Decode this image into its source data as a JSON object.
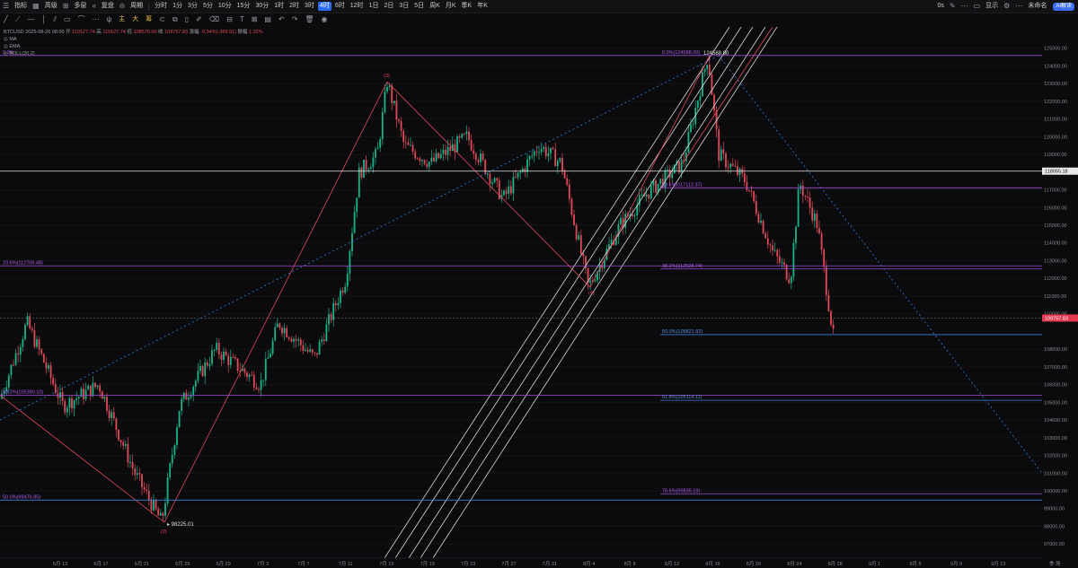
{
  "toolbar": {
    "indicator_label": "指标",
    "advanced_label": "高级",
    "multi_chart_label": "多窗",
    "replay_label": "复盘",
    "period_label": "周期",
    "intervals": [
      "分时",
      "1分",
      "3分",
      "5分",
      "10分",
      "15分",
      "30分",
      "1时",
      "2时",
      "3时",
      "4时",
      "6时",
      "12时",
      "1日",
      "2日",
      "3日",
      "5日",
      "周K",
      "月K",
      "季K",
      "年K"
    ],
    "active_interval": "4时",
    "right_zoom": "0s",
    "right_display": "显示",
    "right_unnamed": "未命名",
    "ai_button": "AI解读"
  },
  "drawing_tools": {
    "yellow_items": [
      "主",
      "大",
      "筹"
    ]
  },
  "legend": {
    "symbol": "BTCUSD",
    "date": "2025-08-26 08:00",
    "open_label": "开",
    "open": "110127.74",
    "high_label": "高",
    "high": "110127.74",
    "low_label": "低",
    "low": "108570.00",
    "close_label": "收",
    "close": "109757.83",
    "change_label": "涨幅",
    "change": "-0.34%(-369.91)",
    "amplitude_label": "振幅",
    "amplitude": "1.32%",
    "ma_label": "MA",
    "ema_label": "EMA",
    "boll_label": "BOLL(20,2)"
  },
  "colors": {
    "up": "#19b38a",
    "down": "#e04a58",
    "fib_line": "#a14dd6",
    "fib_line_blue": "#3c7fd6",
    "fib_text": "#b05cf0",
    "elliott": "#e04a58",
    "white_line": "#d8d8d8",
    "dotted": "#2f7fd9",
    "current_price_bg": "#e5394f",
    "axis_text": "#8a8a90"
  },
  "price_axis": {
    "ticks": [
      "125000.00",
      "124000.00",
      "123000.00",
      "122000.00",
      "121000.00",
      "120000.00",
      "119000.00",
      "117000.00",
      "116000.00",
      "115000.00",
      "114000.00",
      "113000.00",
      "112000.00",
      "111000.00",
      "110000.00",
      "108000.00",
      "107000.00",
      "106000.00",
      "105000.00",
      "104000.00",
      "103000.00",
      "102000.00",
      "101000.00",
      "100000.00",
      "99000.00",
      "98000.00",
      "97000.00"
    ],
    "tick_values": [
      125000,
      124000,
      123000,
      122000,
      121000,
      120000,
      119000,
      117000,
      116000,
      115000,
      114000,
      113000,
      112000,
      111000,
      110000,
      108000,
      107000,
      106000,
      105000,
      104000,
      103000,
      102000,
      101000,
      100000,
      99000,
      98000,
      97000
    ],
    "marked_white": "118055.18",
    "marked_white_value": 118055.18,
    "current_price": "109757.83",
    "current_price_value": 109757.83,
    "min": 96200,
    "max": 126200
  },
  "time_axis": {
    "labels": [
      "6月 13",
      "6月 17",
      "6月 21",
      "6月 25",
      "6月 29",
      "7月 3",
      "7月 7",
      "7月 11",
      "7月 15",
      "7月 19",
      "7月 23",
      "7月 27",
      "7月 31",
      "8月 4",
      "8月 8",
      "8月 12",
      "8月 16",
      "8月 20",
      "8月 24",
      "8月 28",
      "9月 1",
      "9月 5",
      "9月 9",
      "9月 13"
    ],
    "suffix": "季 场"
  },
  "fib_levels": [
    {
      "label": "0.0%(124588.00)",
      "left_label": "0.0%",
      "value": 124588.0,
      "color_key": "fib_line"
    },
    {
      "label": "23.6%(117112.37)",
      "value": 117112.37,
      "color_key": "fib_line"
    },
    {
      "label": "23.6%(112706.48)",
      "value": 112706.48,
      "color_key": "fib_line",
      "left": true
    },
    {
      "label": "38.2%(112528.74)",
      "value": 112528.74,
      "color_key": "fib_line"
    },
    {
      "label": "50.0%(108821.92)",
      "value": 108821.92,
      "color_key": "fib_line_blue"
    },
    {
      "label": "38.2%(105390.10)",
      "value": 105390.1,
      "color_key": "fib_line",
      "left": true
    },
    {
      "label": "61.8%(105114.11)",
      "value": 105114.11,
      "color_key": "fib_line_blue"
    },
    {
      "label": "50.0%(99476.85)",
      "value": 99476.85,
      "color_key": "fib_line_blue",
      "left": true
    },
    {
      "label": "78.6%(99835.19)",
      "value": 99835.19,
      "color_key": "fib_line"
    }
  ],
  "annotations": {
    "high_label": "124588.00",
    "low_label": "98225.01",
    "wave_1": "(1)",
    "wave_3": "(3)",
    "wave_4": "(4)",
    "wave_2": "(2)"
  }
}
